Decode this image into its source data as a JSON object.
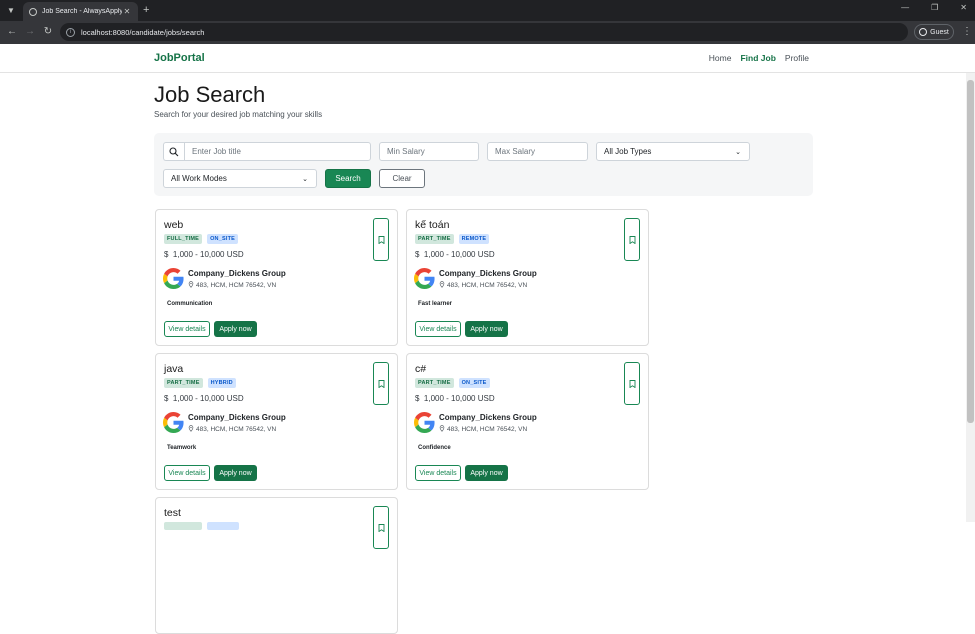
{
  "browser": {
    "tab_title": "Job Search - AlwaysApply",
    "url": "localhost:8080/candidate/jobs/search",
    "profile_label": "Guest"
  },
  "nav": {
    "brand": "JobPortal",
    "links": [
      "Home",
      "Find Job",
      "Profile"
    ]
  },
  "header": {
    "title": "Job Search",
    "subtitle": "Search for your desired job matching your skills"
  },
  "filters": {
    "title_placeholder": "Enter Job title",
    "min_salary_placeholder": "Min Salary",
    "max_salary_placeholder": "Max Salary",
    "job_type_selected": "All Job Types",
    "work_mode_selected": "All Work Modes",
    "search_label": "Search",
    "clear_label": "Clear"
  },
  "card_labels": {
    "view": "View details",
    "apply": "Apply now"
  },
  "jobs": [
    {
      "title": "web",
      "type": "FULL_TIME",
      "mode": "ON_SITE",
      "salary": "1,000 - 10,000 USD",
      "company": "Company_Dickens Group",
      "address": "483, HCM, HCM 76542, VN",
      "skill": "Communication"
    },
    {
      "title": "kế toán",
      "type": "PART_TIME",
      "mode": "REMOTE",
      "salary": "1,000 - 10,000 USD",
      "company": "Company_Dickens Group",
      "address": "483, HCM, HCM 76542, VN",
      "skill": "Fast learner"
    },
    {
      "title": "java",
      "type": "PART_TIME",
      "mode": "HYBRID",
      "salary": "1,000 - 10,000 USD",
      "company": "Company_Dickens Group",
      "address": "483, HCM, HCM 76542, VN",
      "skill": "Teamwork"
    },
    {
      "title": "c#",
      "type": "PART_TIME",
      "mode": "ON_SITE",
      "salary": "1,000 - 10,000 USD",
      "company": "Company_Dickens Group",
      "address": "483, HCM, HCM 76542, VN",
      "skill": "Confidence"
    },
    {
      "title": "test"
    }
  ],
  "colors": {
    "brand_green": "#157347",
    "type_badge_bg": "#d1e7dd",
    "mode_badge_bg": "#cfe2ff"
  }
}
